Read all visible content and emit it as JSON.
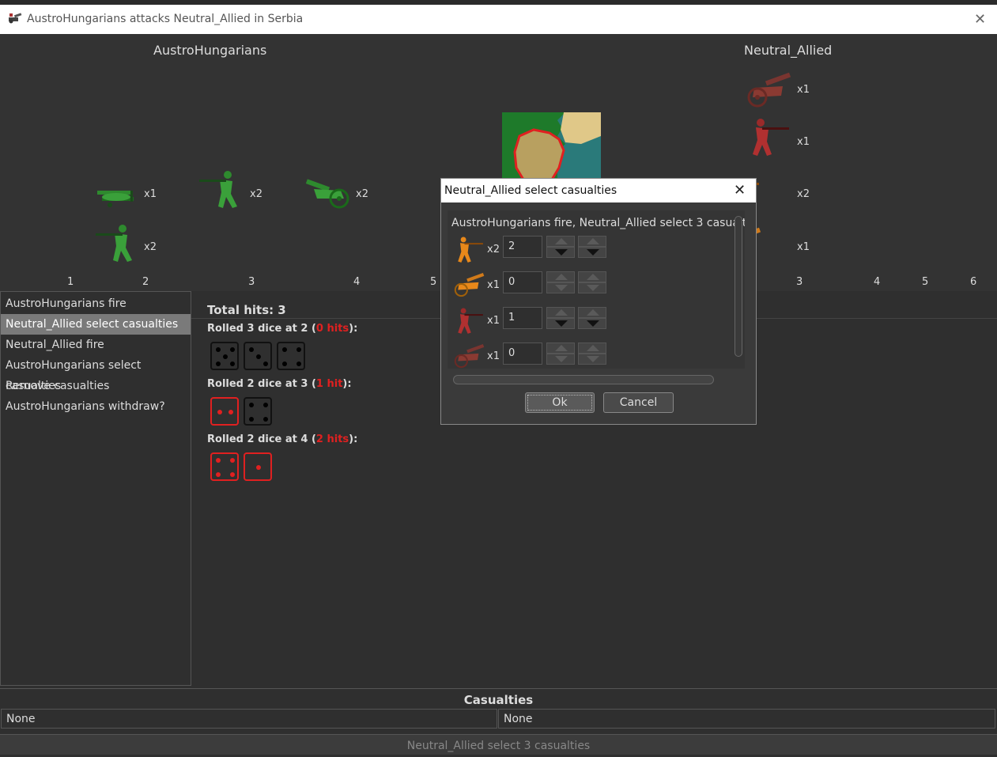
{
  "window": {
    "title": "AustroHungarians attacks Neutral_Allied in Serbia",
    "close_icon": "close-icon"
  },
  "board": {
    "attacker_name": "AustroHungarians",
    "defender_name": "Neutral_Allied",
    "attacker_units": [
      {
        "type": "biplane",
        "mult": "x1"
      },
      {
        "type": "infantry",
        "mult": "x2"
      },
      {
        "type": "infantry",
        "mult": "x2"
      },
      {
        "type": "artillery",
        "mult": "x2"
      }
    ],
    "defender_units": [
      {
        "type": "artillery",
        "mult": "x1"
      },
      {
        "type": "infantry",
        "mult": "x1"
      },
      {
        "type": "infantry",
        "mult": "x2"
      },
      {
        "type": "artillery",
        "mult": "x1"
      }
    ],
    "left_columns": [
      "1",
      "2",
      "3",
      "4",
      "5"
    ],
    "right_columns": [
      "3",
      "4",
      "5",
      "6"
    ]
  },
  "steps": [
    "AustroHungarians fire",
    "Neutral_Allied select casualties",
    "Neutral_Allied fire",
    "AustroHungarians select casualties",
    "Remove casualties",
    "AustroHungarians withdraw?"
  ],
  "selected_step": 1,
  "hits": {
    "total_label": "Total hits:",
    "total": "3",
    "rolls": [
      {
        "prefix": "Rolled 3 dice at 2 (",
        "hits": "0 hits",
        "suffix": "):",
        "dice": [
          5,
          3,
          4
        ],
        "hit": [
          false,
          false,
          false
        ]
      },
      {
        "prefix": "Rolled 2 dice at 3 (",
        "hits": "1 hit",
        "suffix": "):",
        "dice": [
          2,
          4
        ],
        "hit": [
          true,
          false
        ]
      },
      {
        "prefix": "Rolled 2 dice at 4 (",
        "hits": "2 hits",
        "suffix": "):",
        "dice": [
          4,
          1
        ],
        "hit": [
          true,
          true
        ]
      }
    ]
  },
  "casualties": {
    "header": "Casualties",
    "left": "None",
    "right": "None"
  },
  "status": "Neutral_Allied select 3 casualties",
  "dialog": {
    "title": "Neutral_Allied select casualties",
    "message": "AustroHungarians fire,  Neutral_Allied select 3 casualt",
    "rows": [
      {
        "unit": "infantry-orange",
        "mult": "x2",
        "value": "2",
        "up_enabled": false,
        "down_enabled": true
      },
      {
        "unit": "artillery-orange",
        "mult": "x1",
        "value": "0",
        "up_enabled": false,
        "down_enabled": false
      },
      {
        "unit": "infantry-red",
        "mult": "x1",
        "value": "1",
        "up_enabled": false,
        "down_enabled": true
      },
      {
        "unit": "artillery-red",
        "mult": "x1",
        "value": "0",
        "up_enabled": false,
        "down_enabled": false
      }
    ],
    "ok": "Ok",
    "cancel": "Cancel"
  },
  "colors": {
    "green": "#2e8a2e",
    "orange": "#e8881a",
    "darkred": "#8a2a22",
    "hit_red": "#e02020"
  }
}
